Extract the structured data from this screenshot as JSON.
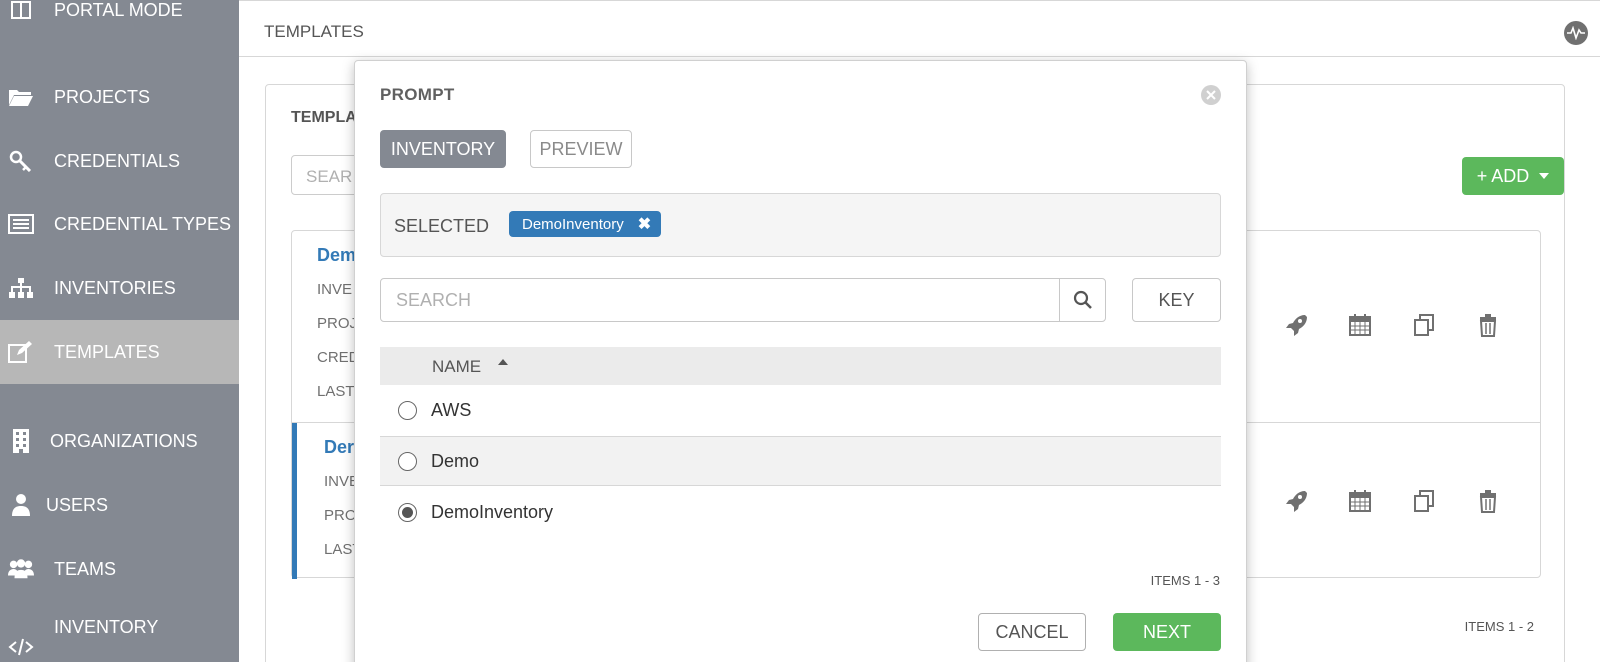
{
  "sidebar": {
    "items": [
      {
        "label": "PORTAL MODE",
        "icon": "portal-icon"
      },
      {
        "label": "PROJECTS",
        "icon": "folder-icon"
      },
      {
        "label": "CREDENTIALS",
        "icon": "key-icon"
      },
      {
        "label": "CREDENTIAL TYPES",
        "icon": "list-icon"
      },
      {
        "label": "INVENTORIES",
        "icon": "sitemap-icon"
      },
      {
        "label": "TEMPLATES",
        "icon": "edit-icon",
        "active": true
      },
      {
        "label": "ORGANIZATIONS",
        "icon": "building-icon"
      },
      {
        "label": "USERS",
        "icon": "user-icon"
      },
      {
        "label": "TEAMS",
        "icon": "users-icon"
      },
      {
        "label": "INVENTORY",
        "icon": "code-icon"
      }
    ]
  },
  "header": {
    "title": "TEMPLATES"
  },
  "panel": {
    "title": "TEMPLA",
    "search_placeholder": "SEAR",
    "add_label": "+ ADD",
    "rows": [
      {
        "name": "Dem",
        "meta": [
          "INVE",
          "PROJ",
          "CRED",
          "LAST"
        ]
      },
      {
        "name": "Der",
        "meta": [
          "INVE",
          "PRO",
          "LAST"
        ]
      }
    ],
    "count": "ITEMS  1 - 2"
  },
  "modal": {
    "title": "PROMPT",
    "tabs": {
      "inventory": "INVENTORY",
      "preview": "PREVIEW"
    },
    "selected_label": "SELECTED",
    "selected_chip": "DemoInventory",
    "search_placeholder": "SEARCH",
    "key_label": "KEY",
    "column_name": "NAME",
    "rows": [
      {
        "name": "AWS",
        "selected": false
      },
      {
        "name": "Demo",
        "selected": false
      },
      {
        "name": "DemoInventory",
        "selected": true
      }
    ],
    "count": "ITEMS  1 - 3",
    "cancel_label": "CANCEL",
    "next_label": "NEXT"
  },
  "colors": {
    "sidebar": "#848992",
    "sidebar_active": "#b7b7b7",
    "accent_blue": "#337ab7",
    "success_green": "#5cb85c"
  }
}
